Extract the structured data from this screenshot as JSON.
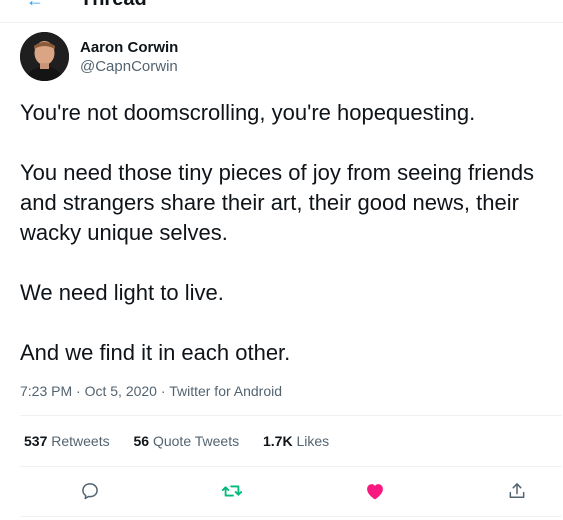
{
  "header": {
    "back_icon": "back-arrow-icon",
    "title": "Thread"
  },
  "author": {
    "name": "Aaron Corwin",
    "handle": "@CapnCorwin",
    "avatar": "profile-photo"
  },
  "tweet": {
    "paragraphs": [
      "You're not doomscrolling, you're hopequesting.",
      "You need those tiny pieces of joy from seeing friends and strangers share their art, their good news, their wacky unique selves.",
      "We need light to live.",
      "And we find it in each other."
    ],
    "time": "7:23 PM",
    "date": "Oct 5, 2020",
    "source": "Twitter for Android",
    "separator": "·"
  },
  "stats": {
    "retweets": {
      "count": "537",
      "label": "Retweets"
    },
    "quotes": {
      "count": "56",
      "label": "Quote Tweets"
    },
    "likes": {
      "count": "1.7K",
      "label": "Likes"
    }
  },
  "actions": {
    "reply_icon": "reply-icon",
    "retweet_icon": "retweet-icon",
    "like_icon": "heart-icon",
    "share_icon": "share-icon"
  },
  "colors": {
    "text": "#0f1419",
    "secondary": "#536471",
    "retweet_green": "#00ba7c",
    "like_red": "#f91880",
    "divider": "#eff3f4",
    "accent": "#1d9bf0"
  }
}
